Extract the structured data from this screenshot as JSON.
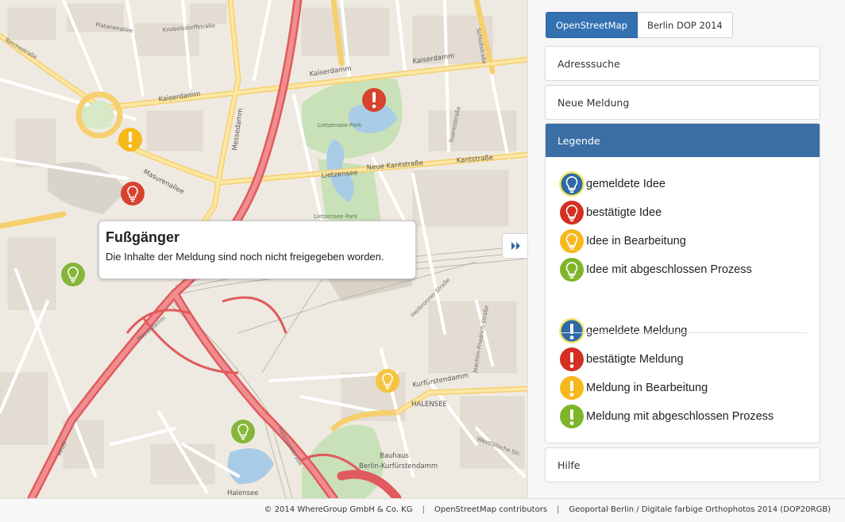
{
  "map": {
    "labels": {
      "reichsstr": "Reichsstraße",
      "platanen": "Platanenallee",
      "knobelsdorff": "Knobelsdorffstraße",
      "kaiserdamm_w": "Kaiserdamm",
      "kaiserdamm_e": "Kaiserdamm",
      "kaiserdamm_mid": "Kaiserdamm",
      "masurenallee": "Masurenallee",
      "messedamm": "Messedamm",
      "neue_kantstr": "Neue Kantstraße",
      "lietzensee": "Lietzensee",
      "kantstr": "Kantstraße",
      "lietzensee_park": "Lietzensee-Park",
      "lietzensee_park2": "Lietzensee-Park",
      "kurfuerstendamm": "Kurfürstendamm",
      "halensee_dist": "HALENSEE",
      "halensee_lake": "Halensee",
      "bauhaus": "Bauhaus",
      "station": "Berlin-Kurfürstendamm",
      "avus": "AVUS",
      "messedamm2": "Messedamm",
      "halenseestr": "Halenseestraße",
      "joachim": "Joachim-Friedrich-Straße",
      "schlossstr": "Schloßstraße",
      "suarez": "Suarezstraße",
      "heilbronner": "Heilbronner Straße",
      "westfaelische": "Westfälische Str."
    }
  },
  "popup": {
    "title": "Fußgänger",
    "body": "Die Inhalte der Meldung sind noch nicht freigegeben worden."
  },
  "sidebar": {
    "layers": {
      "osm": "OpenStreetMap",
      "dop": "Berlin DOP 2014"
    },
    "panels": {
      "adress": "Adresssuche",
      "neue": "Neue Meldung",
      "legende": "Legende",
      "hilfe": "Hilfe"
    },
    "legend": [
      {
        "label": "gemeldete Idee",
        "type": "idea",
        "status": "reported"
      },
      {
        "label": "bestätigte Idee",
        "type": "idea",
        "status": "confirmed"
      },
      {
        "label": "Idee in Bearbeitung",
        "type": "idea",
        "status": "in-progress"
      },
      {
        "label": "Idee mit abgeschlossen Prozess",
        "type": "idea",
        "status": "done"
      },
      {
        "label": "gemeldete Meldung",
        "type": "report",
        "status": "reported"
      },
      {
        "label": "bestätigte Meldung",
        "type": "report",
        "status": "confirmed"
      },
      {
        "label": "Meldung in Bearbeitung",
        "type": "report",
        "status": "in-progress"
      },
      {
        "label": "Meldung mit abgeschlossen Prozess",
        "type": "report",
        "status": "done"
      }
    ]
  },
  "colors": {
    "reported": "#2f6aa6",
    "confirmed": "#d32f23",
    "in_progress": "#f6b81c",
    "done": "#7fb52a",
    "accent": "#3a6ea5"
  },
  "footer": {
    "c1": "© 2014 WhereGroup GmbH & Co. KG",
    "c2": "OpenStreetMap contributors",
    "c3": "Geoportal Berlin / Digitale farbige Orthophotos 2014 (DOP20RGB)"
  }
}
